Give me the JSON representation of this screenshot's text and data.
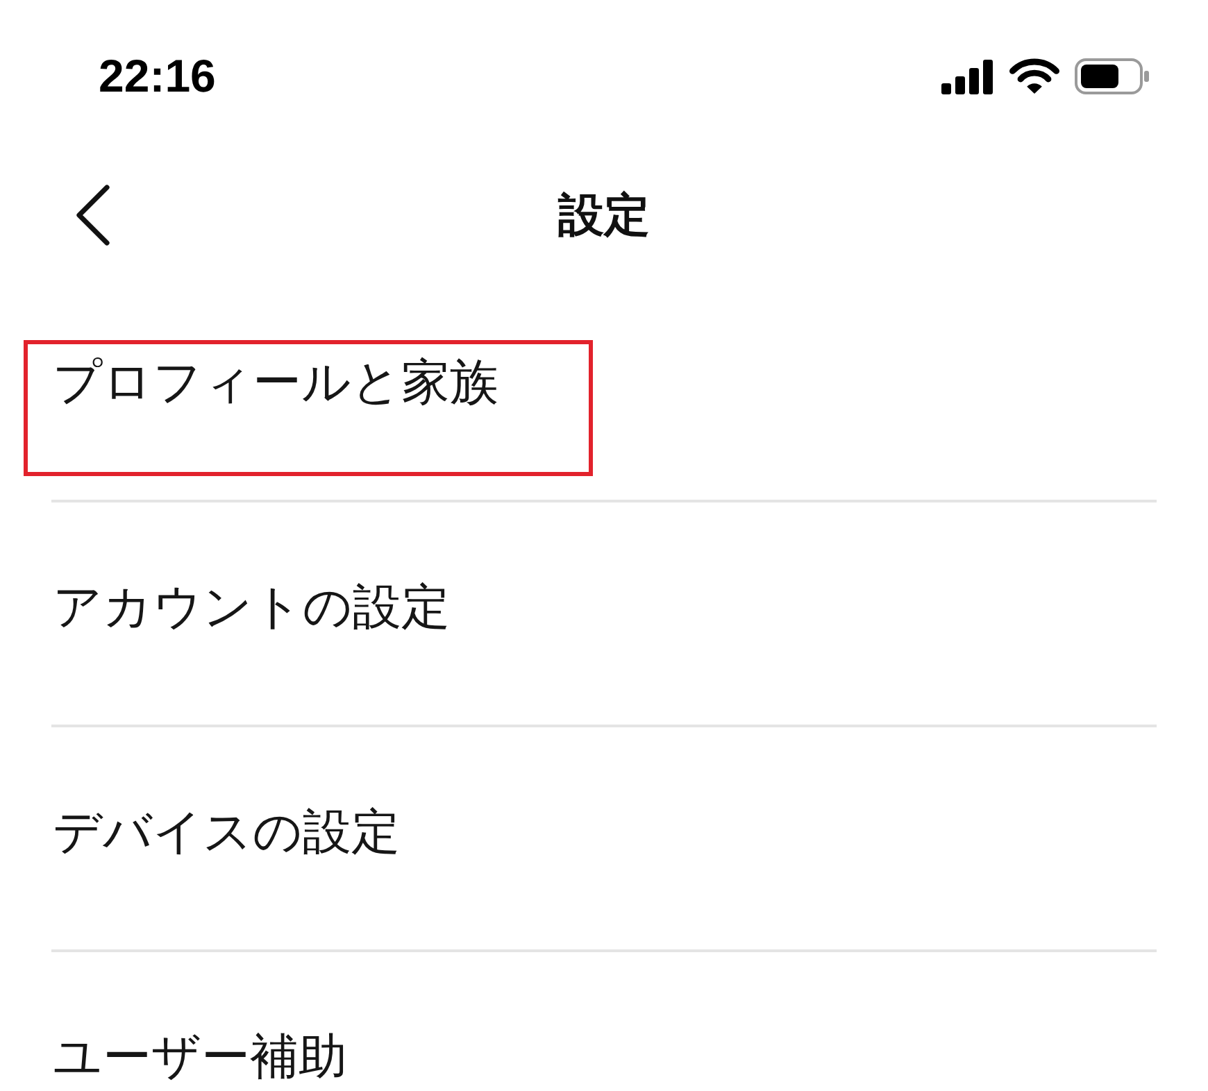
{
  "status_bar": {
    "time": "22:16"
  },
  "header": {
    "title": "設定"
  },
  "menu": {
    "items": [
      {
        "label": "プロフィールと家族",
        "highlighted": true
      },
      {
        "label": "アカウントの設定",
        "highlighted": false
      },
      {
        "label": "デバイスの設定",
        "highlighted": false
      },
      {
        "label": "ユーザー補助",
        "highlighted": false
      }
    ]
  }
}
